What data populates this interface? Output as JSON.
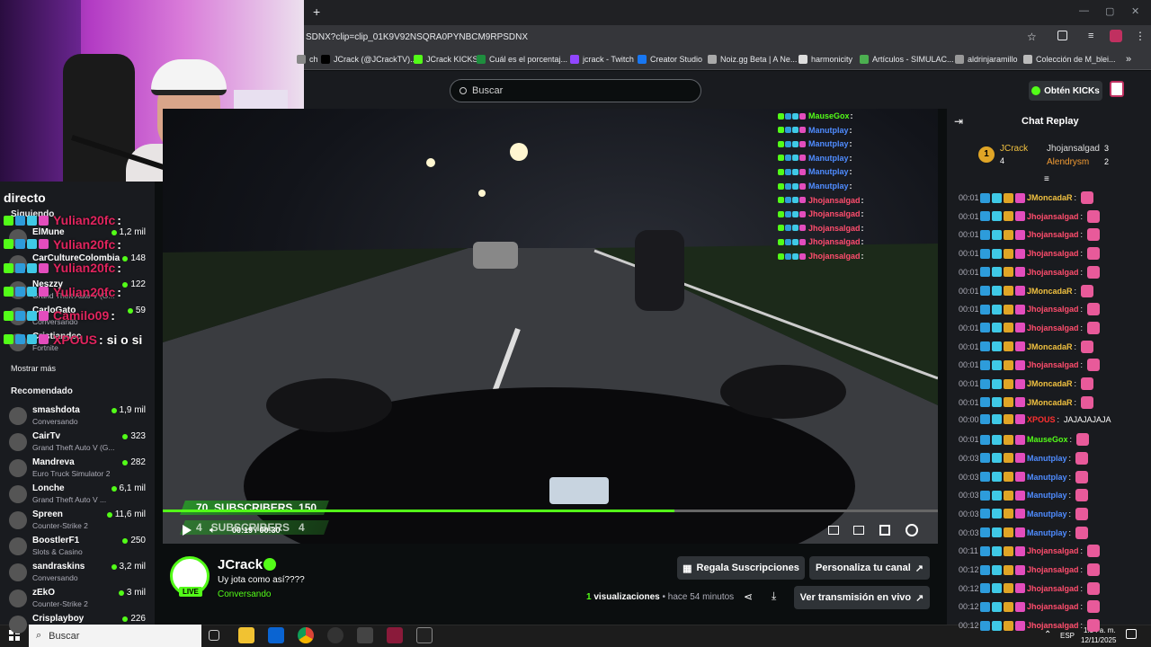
{
  "browser": {
    "url": "SDNX?clip=clip_01K9V92NSQRA0PYNBCM9RPSDNX",
    "bookmarks": [
      "ch",
      "JCrack (@JCrackTV)...",
      "JCrack KICKS",
      "Cuál es el porcentaj...",
      "jcrack - Twitch",
      "Creator Studio",
      "Noiz.gg Beta | A Ne...",
      "harmonicity",
      "Artículos - SIMULAC...",
      "aldrinjaramillo",
      "Colección de M_blei..."
    ],
    "bookmark_colors": [
      "#888",
      "#000",
      "#53fc18",
      "#1e8e3e",
      "#9146ff",
      "#1877f2",
      "#aaa",
      "#ddd",
      "#4caf50",
      "#999",
      "#bbb"
    ]
  },
  "header": {
    "search_placeholder": "Buscar",
    "obten_label": "Obtén KICKs"
  },
  "sidebar": {
    "directo_label": "directo",
    "following_label": "Siguiendo",
    "following": [
      {
        "name": "ElMune",
        "game": "",
        "viewers": "1,2 mil"
      },
      {
        "name": "CarCultureColombia",
        "game": "",
        "viewers": "148"
      },
      {
        "name": "Neszzy",
        "game": "Grand Theft Auto V (G...",
        "viewers": "122"
      },
      {
        "name": "CarloGato",
        "game": "Conversando",
        "viewers": "59"
      },
      {
        "name": "Cristiandec",
        "game": "Fortnite",
        "viewers": ""
      }
    ],
    "more_label": "Mostrar más",
    "recommended_label": "Recomendado",
    "recommended": [
      {
        "name": "smashdota",
        "game": "Conversando",
        "viewers": "1,9 mil"
      },
      {
        "name": "CairTv",
        "game": "Grand Theft Auto V (G...",
        "viewers": "323"
      },
      {
        "name": "Mandreva",
        "game": "Euro Truck Simulator 2",
        "viewers": "282"
      },
      {
        "name": "Lonche",
        "game": "Grand Theft Auto V ...",
        "viewers": "6,1 mil"
      },
      {
        "name": "Spreen",
        "game": "Counter-Strike 2",
        "viewers": "11,6 mil"
      },
      {
        "name": "BoostlerF1",
        "game": "Slots & Casino",
        "viewers": "250"
      },
      {
        "name": "sandraskins",
        "game": "Conversando",
        "viewers": "3,2 mil"
      },
      {
        "name": "zEkO",
        "game": "Counter-Strike 2",
        "viewers": "3 mil"
      },
      {
        "name": "Crisplayboy",
        "game": "",
        "viewers": "226"
      }
    ]
  },
  "overlay_chat": [
    {
      "user": "Yulian20fc",
      "msg": ":"
    },
    {
      "user": "Yulian20fc",
      "msg": ":"
    },
    {
      "user": "Yulian20fc",
      "msg": ":"
    },
    {
      "user": "Yulian20fc",
      "msg": ":"
    },
    {
      "user": "Camilo09",
      "msg": ":"
    },
    {
      "user": "XPOUS",
      "msg": ": si o si"
    }
  ],
  "video_overlay": {
    "chat_names": [
      "MauseGox",
      "Manutplay",
      "Manutplay",
      "Manutplay",
      "Manutplay",
      "Manutplay",
      "Jhojansalgad",
      "Jhojansalgad",
      "Jhojansalgad",
      "Jhojansalgad",
      "Jhojansalgad"
    ],
    "subs_goal_1": "70  SUBSCRIBERS  150",
    "subs_goal_2": "4   SUBSCRIBERS   4",
    "time": "00:19 / 00:30",
    "progress": 0.66
  },
  "channel": {
    "name": "JCrack",
    "title": "Uy jota como así????",
    "category": "Conversando",
    "live_label": "LIVE",
    "gift_label": "Regala Suscripciones",
    "customize_label": "Personaliza tu canal",
    "views_count": "1",
    "views_label": "visualizaciones",
    "ago": "hace 54 minutos",
    "watch_live_label": "Ver transmisión en vivo"
  },
  "chat": {
    "title": "Chat Replay",
    "leader_1_rank": "1",
    "leader_1_name": "JCrack",
    "leader_1_count": "4",
    "leader_2_name": "Jhojansalgad",
    "leader_2_count": "3",
    "leader_3_name": "Alendrysm",
    "leader_3_count": "2",
    "messages": [
      {
        "t": "00:01",
        "u": "JMoncadaR",
        "c": "#f0c040"
      },
      {
        "t": "00:01",
        "u": "Jhojansalgad",
        "c": "#ff4d6d"
      },
      {
        "t": "00:01",
        "u": "Jhojansalgad",
        "c": "#ff4d6d"
      },
      {
        "t": "00:01",
        "u": "Jhojansalgad",
        "c": "#ff4d6d"
      },
      {
        "t": "00:01",
        "u": "Jhojansalgad",
        "c": "#ff4d6d"
      },
      {
        "t": "00:01",
        "u": "JMoncadaR",
        "c": "#f0c040"
      },
      {
        "t": "00:01",
        "u": "Jhojansalgad",
        "c": "#ff4d6d"
      },
      {
        "t": "00:01",
        "u": "Jhojansalgad",
        "c": "#ff4d6d"
      },
      {
        "t": "00:01",
        "u": "JMoncadaR",
        "c": "#f0c040"
      },
      {
        "t": "00:01",
        "u": "Jhojansalgad",
        "c": "#ff4d6d"
      },
      {
        "t": "00:01",
        "u": "JMoncadaR",
        "c": "#f0c040"
      },
      {
        "t": "00:01",
        "u": "JMoncadaR",
        "c": "#f0c040"
      },
      {
        "t": "00:00",
        "u": "XPOUS",
        "c": "#ff3030",
        "m": "JAJAJAJAJA"
      },
      {
        "t": "00:01",
        "u": "MauseGox",
        "c": "#53fc18"
      },
      {
        "t": "00:03",
        "u": "Manutplay",
        "c": "#4f8cff"
      },
      {
        "t": "00:03",
        "u": "Manutplay",
        "c": "#4f8cff"
      },
      {
        "t": "00:03",
        "u": "Manutplay",
        "c": "#4f8cff"
      },
      {
        "t": "00:03",
        "u": "Manutplay",
        "c": "#4f8cff"
      },
      {
        "t": "00:03",
        "u": "Manutplay",
        "c": "#4f8cff"
      },
      {
        "t": "00:11",
        "u": "Jhojansalgad",
        "c": "#ff4d6d"
      },
      {
        "t": "00:12",
        "u": "Jhojansalgad",
        "c": "#ff4d6d"
      },
      {
        "t": "00:12",
        "u": "Jhojansalgad",
        "c": "#ff4d6d"
      },
      {
        "t": "00:12",
        "u": "Jhojansalgad",
        "c": "#ff4d6d"
      },
      {
        "t": "00:12",
        "u": "Jhojansalgad",
        "c": "#ff4d6d"
      }
    ]
  },
  "taskbar": {
    "search_label": "Buscar",
    "lang": "ESP",
    "time": "1:34 a. m.",
    "date": "12/11/2025"
  },
  "colors": {
    "kick_green": "#53fc18",
    "bg": "#0b0e0f",
    "panel": "#191b1f"
  }
}
